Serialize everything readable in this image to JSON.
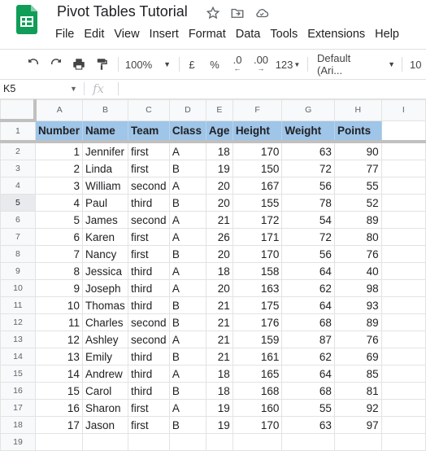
{
  "doc": {
    "title": "Pivot Tables Tutorial"
  },
  "menu": [
    "File",
    "Edit",
    "View",
    "Insert",
    "Format",
    "Data",
    "Tools",
    "Extensions",
    "Help"
  ],
  "toolbar": {
    "zoom": "100%",
    "currency": "£",
    "percent": "%",
    "decrease_decimal": ".0",
    "increase_decimal": ".00",
    "number_format": "123",
    "font": "Default (Ari...",
    "font_size": "10"
  },
  "formula_bar": {
    "cell_ref": "K5",
    "fx": "fx",
    "value": ""
  },
  "sheet": {
    "columns": [
      "A",
      "B",
      "C",
      "D",
      "E",
      "F",
      "G",
      "H",
      "I"
    ],
    "headers": [
      "Number",
      "Name",
      "Team",
      "Class",
      "Age",
      "Height",
      "Weight",
      "Points"
    ],
    "rows": [
      {
        "n": "1",
        "name": "Jennifer",
        "team": "first",
        "cls": "A",
        "age": "18",
        "h": "170",
        "w": "63",
        "p": "90"
      },
      {
        "n": "2",
        "name": "Linda",
        "team": "first",
        "cls": "B",
        "age": "19",
        "h": "150",
        "w": "72",
        "p": "77"
      },
      {
        "n": "3",
        "name": "William",
        "team": "second",
        "cls": "A",
        "age": "20",
        "h": "167",
        "w": "56",
        "p": "55"
      },
      {
        "n": "4",
        "name": "Paul",
        "team": "third",
        "cls": "B",
        "age": "20",
        "h": "155",
        "w": "78",
        "p": "52"
      },
      {
        "n": "5",
        "name": "James",
        "team": "second",
        "cls": "A",
        "age": "21",
        "h": "172",
        "w": "54",
        "p": "89"
      },
      {
        "n": "6",
        "name": "Karen",
        "team": "first",
        "cls": "A",
        "age": "26",
        "h": "171",
        "w": "72",
        "p": "80"
      },
      {
        "n": "7",
        "name": "Nancy",
        "team": "first",
        "cls": "B",
        "age": "20",
        "h": "170",
        "w": "56",
        "p": "76"
      },
      {
        "n": "8",
        "name": "Jessica",
        "team": "third",
        "cls": "A",
        "age": "18",
        "h": "158",
        "w": "64",
        "p": "40"
      },
      {
        "n": "9",
        "name": "Joseph",
        "team": "third",
        "cls": "A",
        "age": "20",
        "h": "163",
        "w": "62",
        "p": "98"
      },
      {
        "n": "10",
        "name": "Thomas",
        "team": "third",
        "cls": "B",
        "age": "21",
        "h": "175",
        "w": "64",
        "p": "93"
      },
      {
        "n": "11",
        "name": "Charles",
        "team": "second",
        "cls": "B",
        "age": "21",
        "h": "176",
        "w": "68",
        "p": "89"
      },
      {
        "n": "12",
        "name": "Ashley",
        "team": "second",
        "cls": "A",
        "age": "21",
        "h": "159",
        "w": "87",
        "p": "76"
      },
      {
        "n": "13",
        "name": "Emily",
        "team": "third",
        "cls": "B",
        "age": "21",
        "h": "161",
        "w": "62",
        "p": "69"
      },
      {
        "n": "14",
        "name": "Andrew",
        "team": "third",
        "cls": "A",
        "age": "18",
        "h": "165",
        "w": "64",
        "p": "85"
      },
      {
        "n": "15",
        "name": "Carol",
        "team": "third",
        "cls": "B",
        "age": "18",
        "h": "168",
        "w": "68",
        "p": "81"
      },
      {
        "n": "16",
        "name": "Sharon",
        "team": "first",
        "cls": "A",
        "age": "19",
        "h": "160",
        "w": "55",
        "p": "92"
      },
      {
        "n": "17",
        "name": "Jason",
        "team": "first",
        "cls": "B",
        "age": "19",
        "h": "170",
        "w": "63",
        "p": "97"
      }
    ]
  }
}
